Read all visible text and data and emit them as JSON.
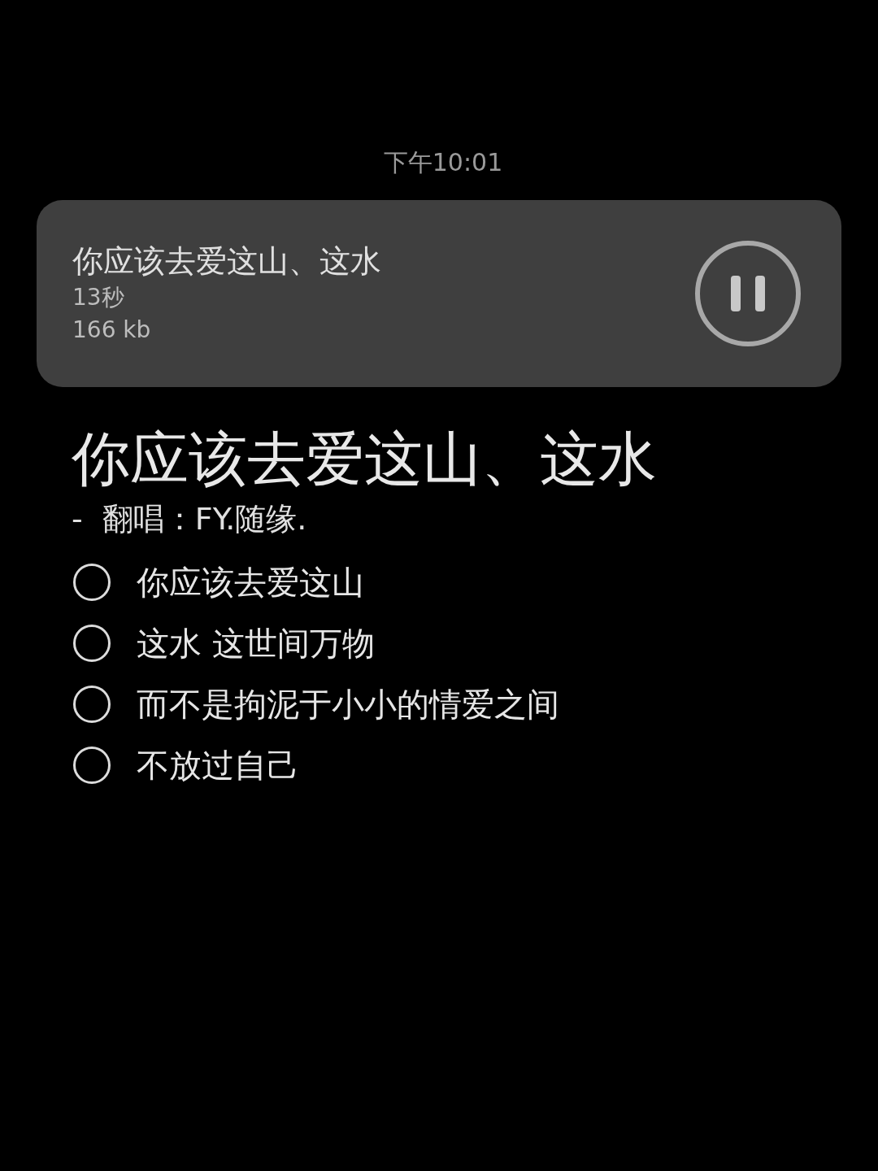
{
  "status_time": "下午10:01",
  "player": {
    "title": "你应该去爱这山、这水",
    "duration": "13秒",
    "size": "166 kb",
    "playing": true
  },
  "heading": "你应该去爱这山、这水",
  "subtitle": "-  翻唱：FY.随缘.",
  "options": [
    {
      "label": "你应该去爱这山",
      "selected": false
    },
    {
      "label": "这水 这世间万物",
      "selected": false
    },
    {
      "label": "而不是拘泥于小小的情爱之间",
      "selected": false
    },
    {
      "label": "不放过自己",
      "selected": false
    }
  ]
}
